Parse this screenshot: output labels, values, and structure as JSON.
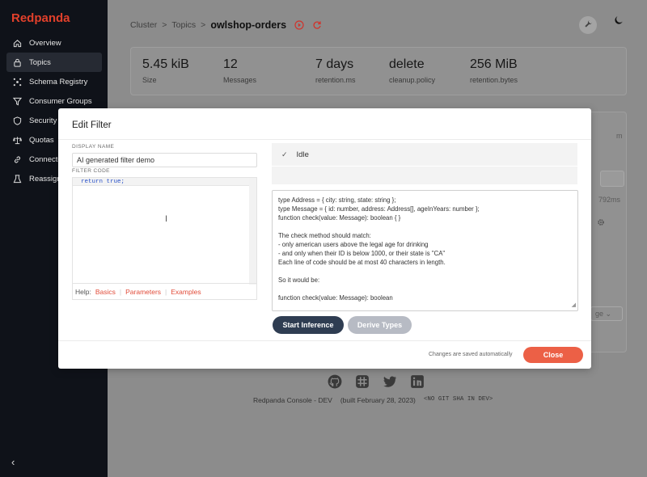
{
  "app": {
    "logo": "Redpanda"
  },
  "sidebar": {
    "items": [
      {
        "label": "Overview",
        "icon": "home-icon"
      },
      {
        "label": "Topics",
        "icon": "lock-icon"
      },
      {
        "label": "Schema Registry",
        "icon": "schema-icon"
      },
      {
        "label": "Consumer Groups",
        "icon": "filter-icon"
      },
      {
        "label": "Security",
        "icon": "shield-icon"
      },
      {
        "label": "Quotas",
        "icon": "scale-icon"
      },
      {
        "label": "Connectors",
        "icon": "link-icon"
      },
      {
        "label": "Reassign Partitions",
        "icon": "beaker-icon"
      }
    ],
    "collapse_glyph": "‹"
  },
  "breadcrumb": {
    "cluster": "Cluster",
    "topics": "Topics",
    "current": "owlshop-orders",
    "sep": ">"
  },
  "stats": [
    {
      "value": "5.45 kiB",
      "label": "Size"
    },
    {
      "value": "12",
      "label": "Messages"
    },
    {
      "value": "7 days",
      "label": "retention.ms"
    },
    {
      "value": "delete",
      "label": "cleanup.policy"
    },
    {
      "value": "256 MiB",
      "label": "retention.bytes"
    }
  ],
  "background": {
    "frag_time": "792ms",
    "frag_m": "m",
    "frag_ge": "ge"
  },
  "modal": {
    "title": "Edit Filter",
    "display_name_label": "DISPLAY NAME",
    "display_name_value": "AI generated filter demo",
    "filter_code_label": "FILTER CODE",
    "code": "return true;",
    "help_label": "Help:",
    "help_links": [
      "Basics",
      "Parameters",
      "Examples"
    ],
    "status_text": "Idle",
    "status_icon": "check-icon",
    "prompt_lines": [
      "type Address = { city: string, state: string };",
      "type Message = { id: number, address: Address[], ageInYears: number };",
      "function check(value: Message): boolean { }",
      "",
      "The check method should match:",
      "- only american users above the legal age for drinking",
      "- and only when their ID is below 1000, or their state is \"CA\"",
      "Each line of code should be at most 40 characters in length.",
      "",
      "So it would be:",
      "",
      "function check(value: Message): boolean"
    ],
    "start_button": "Start Inference",
    "derive_button": "Derive Types",
    "saved_note": "Changes are saved automatically",
    "close_button": "Close"
  },
  "footer": {
    "icons": [
      "github-icon",
      "slack-icon",
      "twitter-icon",
      "linkedin-icon"
    ],
    "product": "Redpanda Console - DEV",
    "built": "(built February 28, 2023)",
    "sha": "<NO GIT SHA IN DEV>"
  },
  "colors": {
    "brand": "#e2402b",
    "primary_button": "#2f3d52",
    "close_button": "#ec6046",
    "sidebar_bg": "#0f1219"
  }
}
